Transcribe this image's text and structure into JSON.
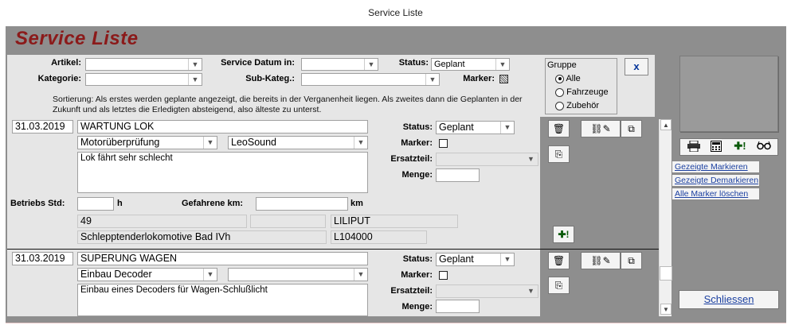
{
  "window": {
    "title": "Service Liste"
  },
  "header": {
    "title": "Service Liste"
  },
  "filters": {
    "artikel_label": "Artikel:",
    "kategorie_label": "Kategorie:",
    "service_datum_label": "Service Datum in:",
    "subkateg_label": "Sub-Kateg.:",
    "status_label": "Status:",
    "status_value": "Geplant",
    "marker_label": "Marker:",
    "sort_note": "Sortierung: Als erstes werden geplante angezeigt, die bereits in der Verganenheit liegen. Als zweites dann die Geplanten in der Zukunft und als letztes die Erledigten absteigend, also älteste zu unterst."
  },
  "gruppe": {
    "title": "Gruppe",
    "options": [
      "Alle",
      "Fahrzeuge",
      "Zubehör"
    ],
    "selected": "Alle"
  },
  "close_x": "x",
  "records": [
    {
      "date": "31.03.2019",
      "title": "WARTUNG LOK",
      "category": "Motorüberprüfung",
      "subcategory": "LeoSound",
      "description": "Lok fährt sehr schlecht",
      "status_label": "Status:",
      "status": "Geplant",
      "marker_label": "Marker:",
      "ersatzteil_label": "Ersatzteil:",
      "menge_label": "Menge:",
      "betriebs_label": "Betriebs Std:",
      "betriebs_unit": "h",
      "km_label": "Gefahrene km:",
      "km_unit": "km",
      "info1": "49",
      "info2": "LILIPUT",
      "info3": "Schlepptenderlokomotive Bad IVh",
      "info4": "L104000"
    },
    {
      "date": "31.03.2019",
      "title": "SUPERUNG WAGEN",
      "category": "Einbau Decoder",
      "subcategory": "",
      "description": "Einbau eines Decoders für Wagen-Schlußlicht",
      "status_label": "Status:",
      "status": "Geplant",
      "marker_label": "Marker:",
      "ersatzteil_label": "Ersatzteil:",
      "menge_label": "Menge:"
    }
  ],
  "sidebar": {
    "mark_shown": "Gezeigte Markieren",
    "unmark_shown": "Gezeigte Demarkieren",
    "clear_markers": "Alle Marker löschen",
    "close": "Schliessen"
  },
  "icons": {
    "delete": "trash-icon",
    "edit": "edit-icon",
    "copy": "copy-icon",
    "add": "add-icon",
    "print": "print-icon",
    "calc": "calculator-icon",
    "glasses": "glasses-icon"
  }
}
